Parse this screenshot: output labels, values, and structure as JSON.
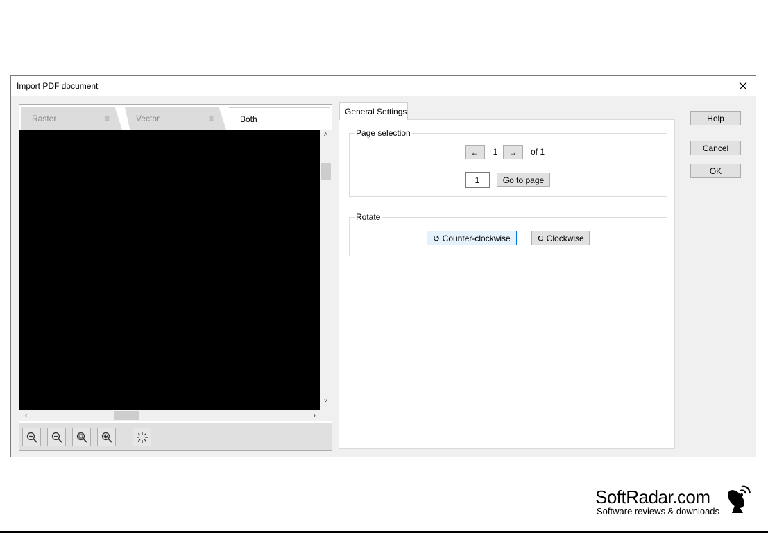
{
  "dialog": {
    "title": "Import PDF document",
    "close_icon": "close-icon"
  },
  "preview": {
    "tabs": [
      {
        "label": "Raster",
        "active": false
      },
      {
        "label": "Vector",
        "active": false
      },
      {
        "label": "Both",
        "active": true
      }
    ],
    "menu_glyph": "≡",
    "scroll_up": "˄",
    "scroll_down": "˅",
    "scroll_left": "‹",
    "scroll_right": "›",
    "toolbar_icons": [
      "zoom-in-icon",
      "zoom-out-icon",
      "zoom-fit-icon",
      "zoom-area-icon",
      "pan-loading-icon"
    ]
  },
  "settings": {
    "tab_label": "General Settings",
    "page_selection": {
      "legend": "Page selection",
      "prev_label": "←",
      "current_page": "1",
      "next_label": "→",
      "of_label": "of 1",
      "input_value": "1",
      "goto_label": "Go to page"
    },
    "rotate": {
      "legend": "Rotate",
      "ccw_label": "↺ Counter-clockwise",
      "cw_label": "↻ Clockwise"
    }
  },
  "actions": {
    "help_label": "Help",
    "cancel_label": "Cancel",
    "ok_label": "OK"
  },
  "watermark": {
    "name": "SoftRadar.com",
    "tagline": "Software reviews & downloads",
    "logo_icon": "satellite-dish-icon"
  }
}
